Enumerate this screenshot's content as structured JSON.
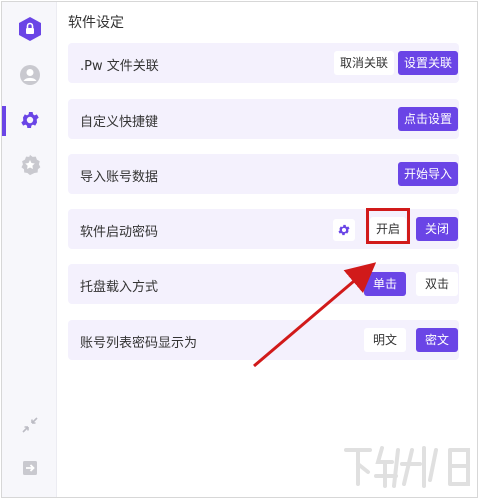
{
  "sidebar": {
    "logo_icon": "app-lock-shield-icon",
    "items": [
      {
        "icon": "user-icon",
        "active": false
      },
      {
        "icon": "gear-icon",
        "active": true
      },
      {
        "icon": "badge-star-icon",
        "active": false
      }
    ],
    "bottom": [
      {
        "icon": "collapse-arrows-icon"
      },
      {
        "icon": "logout-icon"
      }
    ]
  },
  "page": {
    "title": "软件设定"
  },
  "rows": [
    {
      "label": ".Pw 文件关联",
      "buttons": [
        "取消关联",
        "设置关联"
      ]
    },
    {
      "label": "自定义快捷键",
      "buttons": [
        "点击设置"
      ]
    },
    {
      "label": "导入账号数据",
      "buttons": [
        "开始导入"
      ]
    },
    {
      "label": "软件启动密码",
      "buttons": [
        "开启",
        "关闭"
      ]
    },
    {
      "label": "托盘载入方式",
      "buttons": [
        "单击",
        "双击"
      ]
    },
    {
      "label": "账号列表密码显示为",
      "buttons": [
        "明文",
        "密文"
      ]
    }
  ],
  "colors": {
    "accent": "#6a45e6",
    "row_bg": "#f4f1fd",
    "annotation": "#d11a1a"
  },
  "watermark_icon": "download-site-watermark"
}
